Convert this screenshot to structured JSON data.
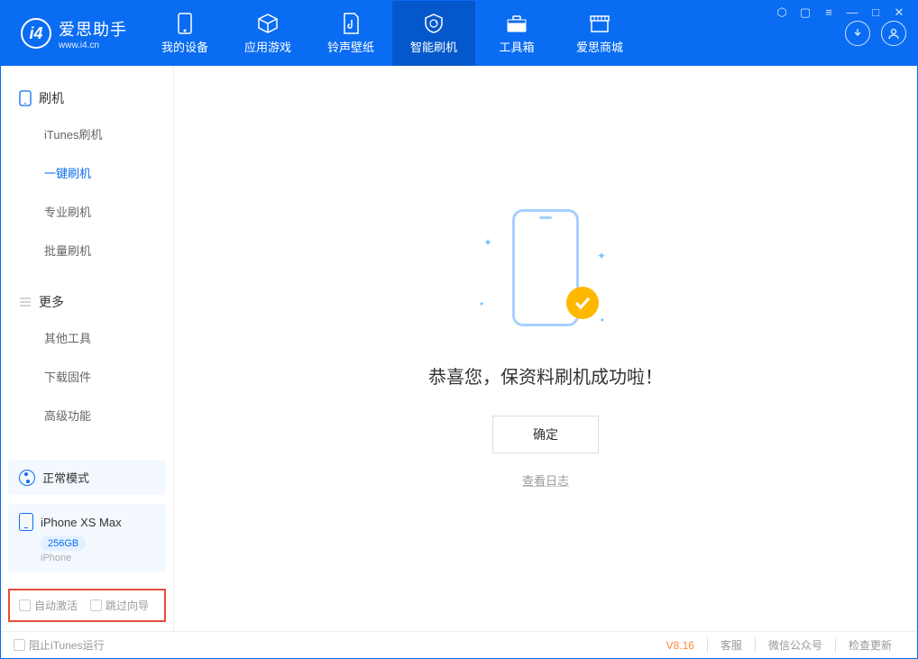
{
  "app": {
    "name": "爱思助手",
    "url": "www.i4.cn"
  },
  "nav": [
    {
      "label": "我的设备"
    },
    {
      "label": "应用游戏"
    },
    {
      "label": "铃声壁纸"
    },
    {
      "label": "智能刷机"
    },
    {
      "label": "工具箱"
    },
    {
      "label": "爱思商城"
    }
  ],
  "sidebar": {
    "section1": {
      "title": "刷机",
      "items": [
        "iTunes刷机",
        "一键刷机",
        "专业刷机",
        "批量刷机"
      ]
    },
    "section2": {
      "title": "更多",
      "items": [
        "其他工具",
        "下载固件",
        "高级功能"
      ]
    }
  },
  "device": {
    "mode": "正常模式",
    "name": "iPhone XS Max",
    "capacity": "256GB",
    "type": "iPhone"
  },
  "options": {
    "auto_activate": "自动激活",
    "skip_guide": "跳过向导"
  },
  "main": {
    "success": "恭喜您，保资料刷机成功啦！",
    "ok": "确定",
    "view_log": "查看日志"
  },
  "footer": {
    "block_itunes": "阻止iTunes运行",
    "version": "V8.16",
    "links": [
      "客服",
      "微信公众号",
      "检查更新"
    ]
  }
}
